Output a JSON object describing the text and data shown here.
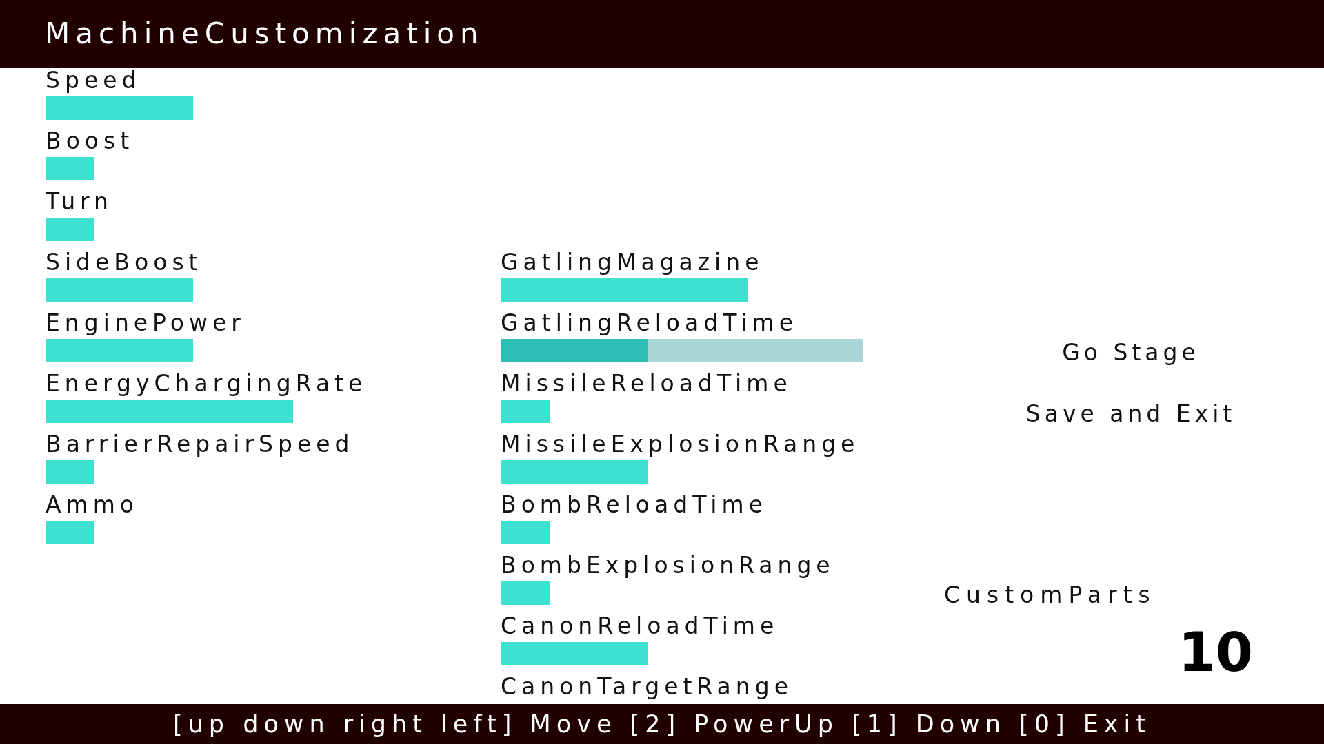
{
  "header": {
    "title": "MachineCustomization"
  },
  "machine_stats": [
    {
      "label": "Speed",
      "level": 0.408,
      "selected": false
    },
    {
      "label": "Boost",
      "level": 0.135,
      "selected": false
    },
    {
      "label": "Turn",
      "level": 0.135,
      "selected": false
    },
    {
      "label": "SideBoost",
      "level": 0.408,
      "selected": false
    },
    {
      "label": "EnginePower",
      "level": 0.408,
      "selected": false
    },
    {
      "label": "EnergyChargingRate",
      "level": 0.683,
      "selected": false
    },
    {
      "label": "BarrierRepairSpeed",
      "level": 0.135,
      "selected": false
    },
    {
      "label": "Ammo",
      "level": 0.135,
      "selected": false
    }
  ],
  "weapon_stats": [
    {
      "label": "GatlingMagazine",
      "level": 0.683,
      "selected": false
    },
    {
      "label": "GatlingReloadTime",
      "level": 0.408,
      "selected": true
    },
    {
      "label": "MissileReloadTime",
      "level": 0.135,
      "selected": false
    },
    {
      "label": "MissileExplosionRange",
      "level": 0.408,
      "selected": false
    },
    {
      "label": "BombReloadTime",
      "level": 0.135,
      "selected": false
    },
    {
      "label": "BombExplosionRange",
      "level": 0.135,
      "selected": false
    },
    {
      "label": "CanonReloadTime",
      "level": 0.408,
      "selected": false
    },
    {
      "label": "CanonTargetRange",
      "selected": false
    }
  ],
  "menu": [
    {
      "label": "Go Stage",
      "selected": false
    },
    {
      "label": "Save and Exit",
      "selected": false
    }
  ],
  "custom_parts": {
    "label": "CustomParts",
    "count": "10"
  },
  "footer": {
    "controls_hint": "[up down right left] Move [2] PowerUp [1] Down [0] Exit"
  }
}
